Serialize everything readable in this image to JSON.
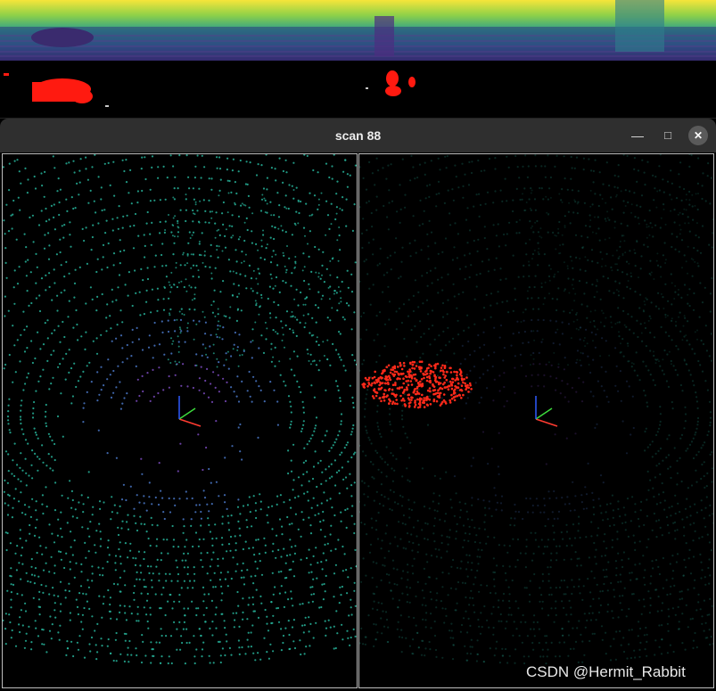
{
  "window": {
    "title": "scan 88",
    "minimize_icon": "minimize-icon",
    "maximize_icon": "maximize-icon",
    "close_icon": "close-icon"
  },
  "watermark": "CSDN @Hermit_Rabbit",
  "colors": {
    "titlebar": "#2f2f2f",
    "point_cyan": "#27b39a",
    "point_blue": "#4a78c8",
    "point_purple": "#7b4bc0",
    "point_red": "#ff2a1a",
    "axis_x": "#ff3b30",
    "axis_y": "#3ddc3d",
    "axis_z": "#2f5bff"
  }
}
